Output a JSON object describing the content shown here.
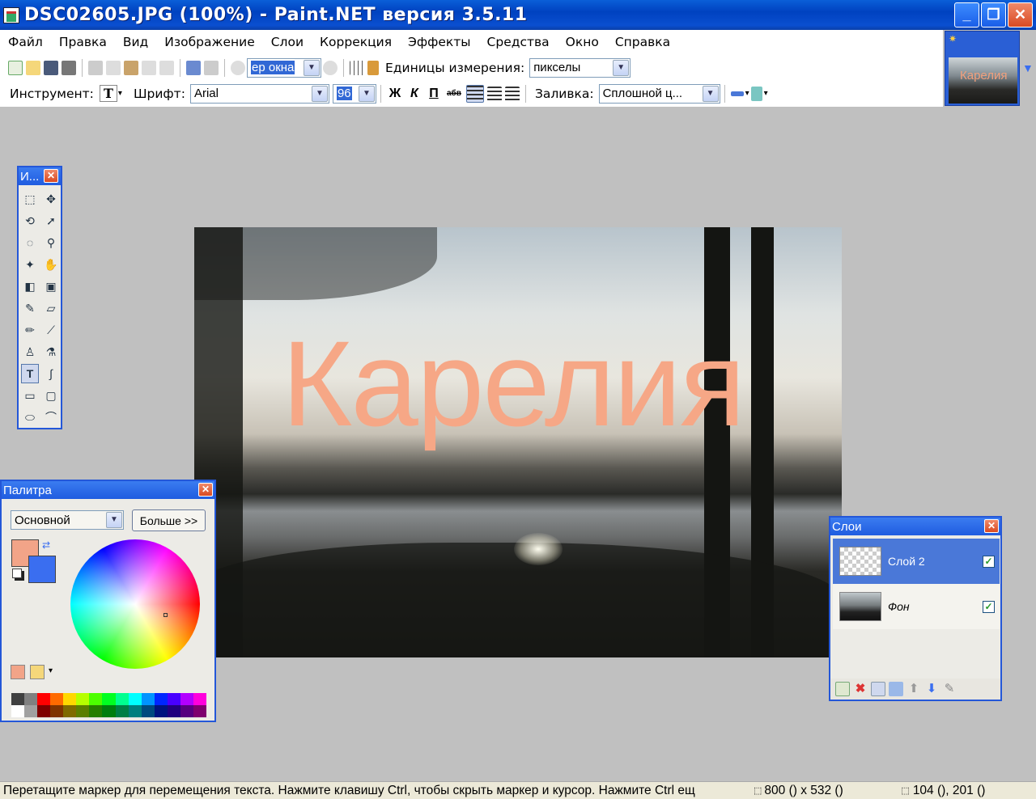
{
  "window": {
    "title": "DSC02605.JPG (100%) - Paint.NET версия 3.5.11"
  },
  "menu": [
    "Файл",
    "Правка",
    "Вид",
    "Изображение",
    "Слои",
    "Коррекция",
    "Эффекты",
    "Средства",
    "Окно",
    "Справка"
  ],
  "toolbar1": {
    "zoom_value": "ер окна",
    "units_label": "Единицы измерения:",
    "units_value": "пикселы"
  },
  "toolbar2": {
    "tool_label": "Инструмент:",
    "font_label": "Шрифт:",
    "font_value": "Arial",
    "size_value": "96",
    "bold": "Ж",
    "italic": "К",
    "underline": "П",
    "strike": "абв",
    "fill_label": "Заливка:",
    "fill_value": "Сплошной ц..."
  },
  "thumbnail": {
    "text": "Карелия"
  },
  "canvas": {
    "text": "Карелия"
  },
  "tools_panel": {
    "title": "И..."
  },
  "palette_panel": {
    "title": "Палитра",
    "mode_value": "Основной",
    "more_button": "Больше >>",
    "primary_color": "#f2a488",
    "secondary_color": "#3a6ef0"
  },
  "layers_panel": {
    "title": "Слои",
    "layers": [
      {
        "name": "Слой 2",
        "selected": true
      },
      {
        "name": "Фон",
        "selected": false
      }
    ]
  },
  "status": {
    "message": "Перетащите маркер для перемещения текста. Нажмите клавишу Ctrl, чтобы скрыть маркер и курсор. Нажмите Ctrl ещ",
    "image_size": "800 () x 532 ()",
    "cursor_pos": "104 (), 201 ()"
  },
  "palette_colors": [
    "#404040",
    "#808080",
    "#ff0000",
    "#ff6a00",
    "#ffd800",
    "#b6ff00",
    "#4cff00",
    "#00ff21",
    "#00ff90",
    "#00ffff",
    "#0094ff",
    "#0026ff",
    "#4800ff",
    "#b200ff",
    "#ff00dc",
    "#ffffff",
    "#a0a0a0",
    "#7f0000",
    "#7f3300",
    "#7f6a00",
    "#5b7f00",
    "#267f00",
    "#007f0e",
    "#007f46",
    "#007f7f",
    "#004a7f",
    "#00137f",
    "#21007f",
    "#57007f",
    "#7f006e"
  ]
}
